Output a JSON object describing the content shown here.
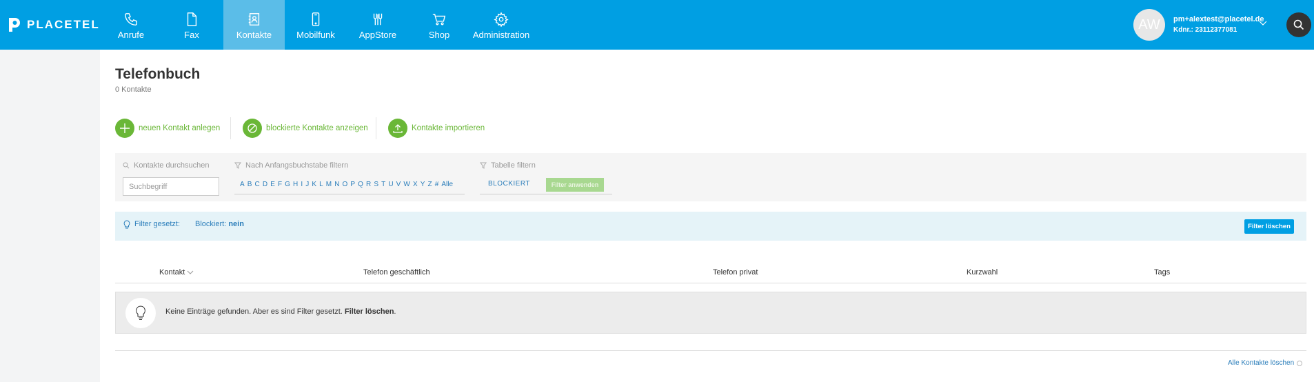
{
  "brand": {
    "name": "PLACETEL"
  },
  "nav": {
    "items": [
      {
        "label": "Anrufe",
        "icon": "phone-icon"
      },
      {
        "label": "Fax",
        "icon": "document-icon"
      },
      {
        "label": "Kontakte",
        "icon": "contact-book-icon"
      },
      {
        "label": "Mobilfunk",
        "icon": "mobile-icon"
      },
      {
        "label": "AppStore",
        "icon": "appstore-icon"
      },
      {
        "label": "Shop",
        "icon": "cart-icon"
      },
      {
        "label": "Administration",
        "icon": "gear-icon"
      }
    ],
    "active": "Kontakte"
  },
  "user": {
    "initials": "AW",
    "email": "pm+alextest@placetel.de",
    "kdnr": "Kdnr.: 23112377081"
  },
  "page": {
    "title": "Telefonbuch",
    "count": "0 Kontakte"
  },
  "actions": {
    "new_contact": "neuen Kontakt anlegen",
    "blocked_contacts": "blockierte Kontakte anzeigen",
    "import_contacts": "Kontakte importieren"
  },
  "filters": {
    "search_label": "Kontakte durchsuchen",
    "search_placeholder": "Suchbegriff",
    "letter_label": "Nach Anfangsbuchstabe filtern",
    "letters": [
      "A",
      "B",
      "C",
      "D",
      "E",
      "F",
      "G",
      "H",
      "I",
      "J",
      "K",
      "L",
      "M",
      "N",
      "O",
      "P",
      "Q",
      "R",
      "S",
      "T",
      "U",
      "V",
      "W",
      "X",
      "Y",
      "Z",
      "#",
      "Alle"
    ],
    "table_label": "Tabelle filtern",
    "blockiert": "BLOCKIERT",
    "apply": "Filter anwenden"
  },
  "active_filter": {
    "label": "Filter gesetzt:",
    "key": "Blockiert:",
    "value": "nein",
    "clear": "Filter löschen"
  },
  "table": {
    "columns": [
      "Kontakt",
      "Telefon geschäftlich",
      "Telefon privat",
      "Kurzwahl",
      "Tags"
    ],
    "empty_text": "Keine Einträge gefunden. Aber es sind Filter gesetzt.",
    "empty_link": "Filter löschen"
  },
  "footer": {
    "delete_all": "Alle Kontakte löschen"
  },
  "colors": {
    "brand_blue": "#009fe3",
    "active_nav": "#5bbde8",
    "action_green": "#6ab737",
    "link_blue": "#2a7dba"
  }
}
